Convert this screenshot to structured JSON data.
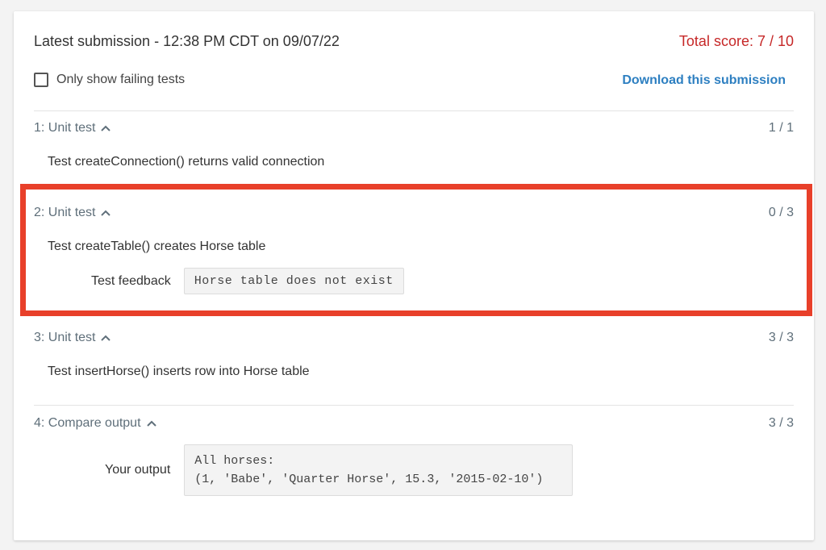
{
  "header": {
    "title": "Latest submission - 12:38 PM CDT on 09/07/22",
    "total_score": "Total score: 7 / 10"
  },
  "filter": {
    "checkbox_label": "Only show failing tests",
    "checked": false
  },
  "download_label": "Download this submission",
  "tests": [
    {
      "title": "1: Unit test",
      "score": "1 / 1",
      "description": "Test createConnection() returns valid connection"
    },
    {
      "title": "2: Unit test",
      "score": "0 / 3",
      "description": "Test createTable() creates Horse table",
      "feedback_label": "Test feedback",
      "feedback": "Horse table does not exist"
    },
    {
      "title": "3: Unit test",
      "score": "3 / 3",
      "description": "Test insertHorse() inserts row into Horse table"
    },
    {
      "title": "4: Compare output",
      "score": "3 / 3",
      "output_label": "Your output",
      "output": "All horses:\n(1, 'Babe', 'Quarter Horse', 15.3, '2015-02-10')"
    }
  ],
  "colors": {
    "score_red": "#c62828",
    "link_blue": "#2d7fc1",
    "highlight_red": "#e8402a"
  },
  "icons": {
    "chevron": "chevron-up-icon"
  }
}
